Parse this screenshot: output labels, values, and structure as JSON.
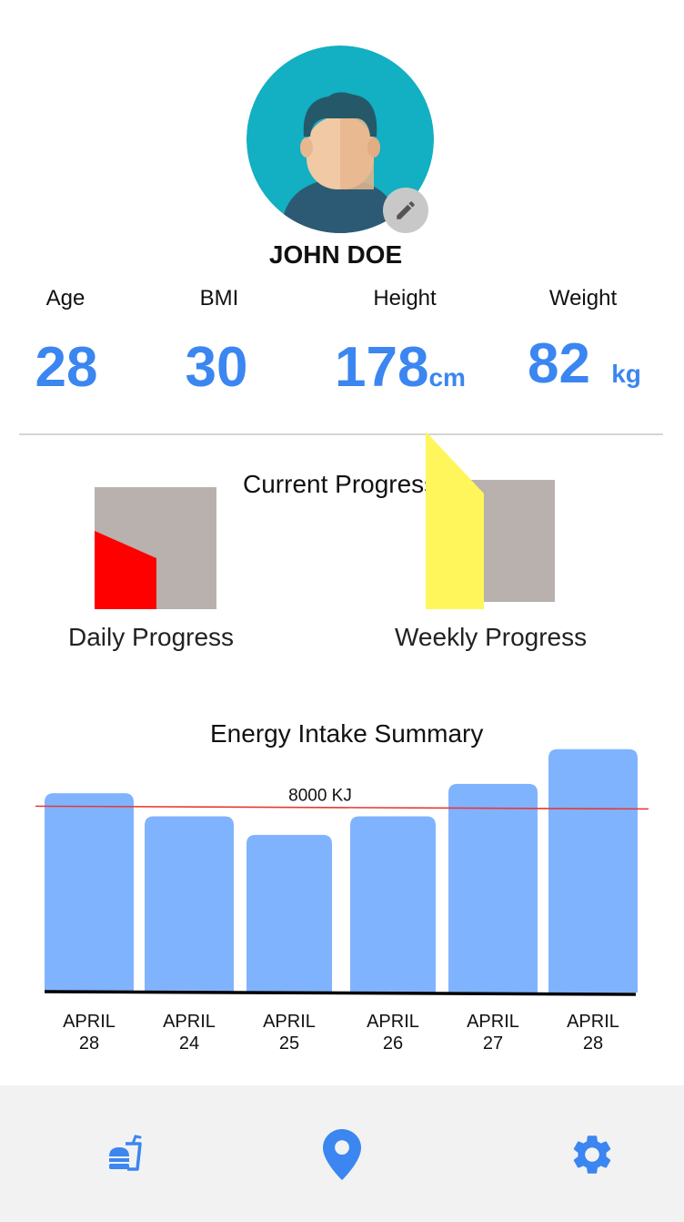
{
  "profile": {
    "name": "JOHN DOE",
    "avatar_icon": "user-avatar-icon",
    "edit_icon": "pencil-icon"
  },
  "stats": [
    {
      "label": "Age",
      "value": "28",
      "unit": ""
    },
    {
      "label": "BMI",
      "value": "30",
      "unit": ""
    },
    {
      "label": "Height",
      "value": "178",
      "unit": "cm"
    },
    {
      "label": "Weight",
      "value": "82",
      "unit": "kg"
    }
  ],
  "progress": {
    "title": "Current Progress",
    "daily_label": "Daily Progress",
    "weekly_label": "Weekly Progress"
  },
  "energy": {
    "title": "Energy Intake Summary",
    "target_label": "8000 KJ",
    "bar_color": "#80b3fd",
    "target_color": "#e53935"
  },
  "chart_data": {
    "type": "bar",
    "title": "Energy Intake Summary",
    "categories": [
      {
        "month": "APRIL",
        "day": "28"
      },
      {
        "month": "APRIL",
        "day": "24"
      },
      {
        "month": "APRIL",
        "day": "25"
      },
      {
        "month": "APRIL",
        "day": "26"
      },
      {
        "month": "APRIL",
        "day": "27"
      },
      {
        "month": "APRIL",
        "day": "28"
      }
    ],
    "values": [
      8600,
      7600,
      6800,
      7600,
      9000,
      10500
    ],
    "target": 8000,
    "ylim": [
      0,
      11000
    ]
  },
  "nav": {
    "items": [
      {
        "icon": "food-drink-icon"
      },
      {
        "icon": "location-pin-icon"
      },
      {
        "icon": "gear-icon"
      }
    ],
    "accent": "#3b86f0"
  }
}
